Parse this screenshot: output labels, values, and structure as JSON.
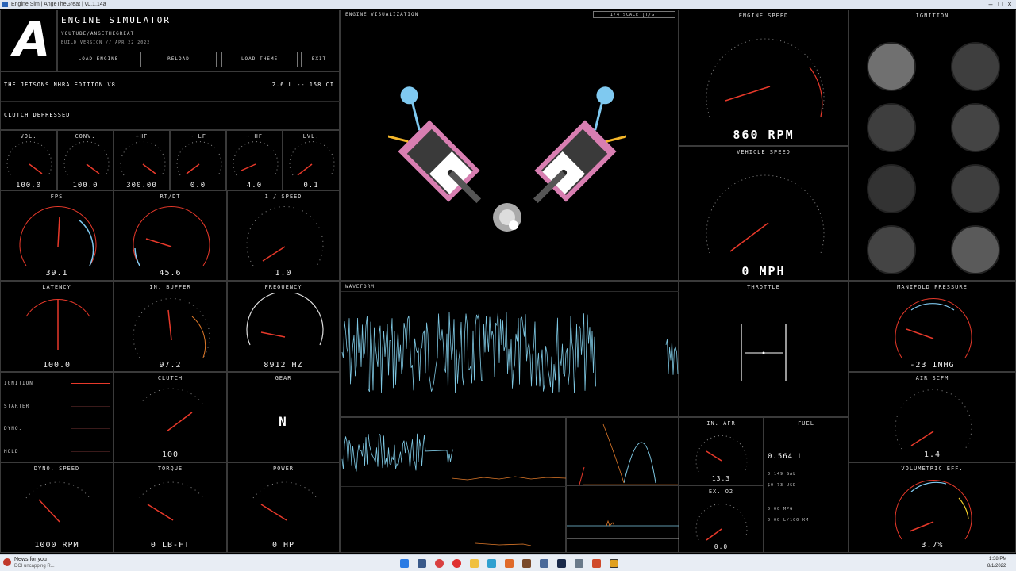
{
  "window": {
    "title": "Engine Sim | AngeTheGreat | v0.1.14a"
  },
  "header": {
    "logo": "A",
    "app_title": "ENGINE SIMULATOR",
    "channel": "YOUTUBE/ANGETHEGREAT",
    "build": "BUILD VERSION // APR 22 2022",
    "buttons": [
      "LOAD ENGINE",
      "RELOAD",
      "LOAD THEME",
      "EXIT"
    ]
  },
  "engine": {
    "name": "THE JETSONS NHRA EDITION V8",
    "displacement": "2.6 L -- 158 CI",
    "clutch_status": "CLUTCH DEPRESSED"
  },
  "gauges": {
    "vol": {
      "label": "VOL.",
      "value": "100.0"
    },
    "conv": {
      "label": "CONV.",
      "value": "100.0"
    },
    "hf_plus": {
      "label": "+HF",
      "value": "300.00"
    },
    "lf": {
      "label": "~ LF",
      "value": "0.0"
    },
    "hf": {
      "label": "~ HF",
      "value": "4.0"
    },
    "lvl": {
      "label": "LVL.",
      "value": "0.1"
    },
    "fps": {
      "label": "FPS",
      "value": "39.1"
    },
    "rtdt": {
      "label": "RT/DT",
      "value": "45.6"
    },
    "inv_speed": {
      "label": "1 / SPEED",
      "value": "1.0"
    },
    "latency": {
      "label": "LATENCY",
      "value": "100.0"
    },
    "in_buffer": {
      "label": "IN. BUFFER",
      "value": "97.2"
    },
    "frequency": {
      "label": "FREQUENCY",
      "value": "8912 HZ"
    },
    "clutch": {
      "label": "CLUTCH",
      "value": "100"
    },
    "gear": {
      "label": "GEAR",
      "value": "N"
    },
    "dyno_speed": {
      "label": "DYNO. SPEED",
      "value": "1000 RPM"
    },
    "torque": {
      "label": "TORQUE",
      "value": "0 LB-FT"
    },
    "power": {
      "label": "POWER",
      "value": "0 HP"
    },
    "engine_speed": {
      "label": "ENGINE SPEED",
      "value": "860 RPM"
    },
    "vehicle_speed": {
      "label": "VEHICLE SPEED",
      "value": "0 MPH"
    },
    "throttle": {
      "label": "THROTTLE"
    },
    "in_afr": {
      "label": "IN. AFR",
      "value": "13.3"
    },
    "ex_o2": {
      "label": "EX. O2",
      "value": "0.0"
    },
    "manifold_pressure": {
      "label": "MANIFOLD PRESSURE",
      "value": "-23 INHG"
    },
    "air_scfm": {
      "label": "AIR SCFM",
      "value": "1.4"
    },
    "volumetric_eff": {
      "label": "VOLUMETRIC EFF.",
      "value": "3.7%"
    }
  },
  "status_lines": [
    "IGNITION",
    "STARTER",
    "DYNO.",
    "HOLD"
  ],
  "fuel": {
    "label": "FUEL",
    "value": "0.564 L",
    "lines": [
      "0.149 GAL",
      "$0.73 USD",
      "0.00 MPG",
      "0.00 L/100 KM"
    ]
  },
  "visualization": {
    "title": "ENGINE VISUALIZATION",
    "scale_label": "1/4 SCALE [T/G]"
  },
  "waveform": {
    "title": "WAVEFORM"
  },
  "ignition": {
    "title": "IGNITION"
  },
  "taskbar": {
    "news_title": "News for you",
    "news_sub": "DCI uncapping R...",
    "time": "1:38 PM",
    "date": "8/1/2022"
  },
  "colors": {
    "accent_red": "#e8392a",
    "accent_orange": "#e07a2a",
    "wave_blue": "#7ec8e3",
    "pink": "#f08cc4",
    "light_blue": "#7fc9f0",
    "yellow": "#f5b72a"
  }
}
